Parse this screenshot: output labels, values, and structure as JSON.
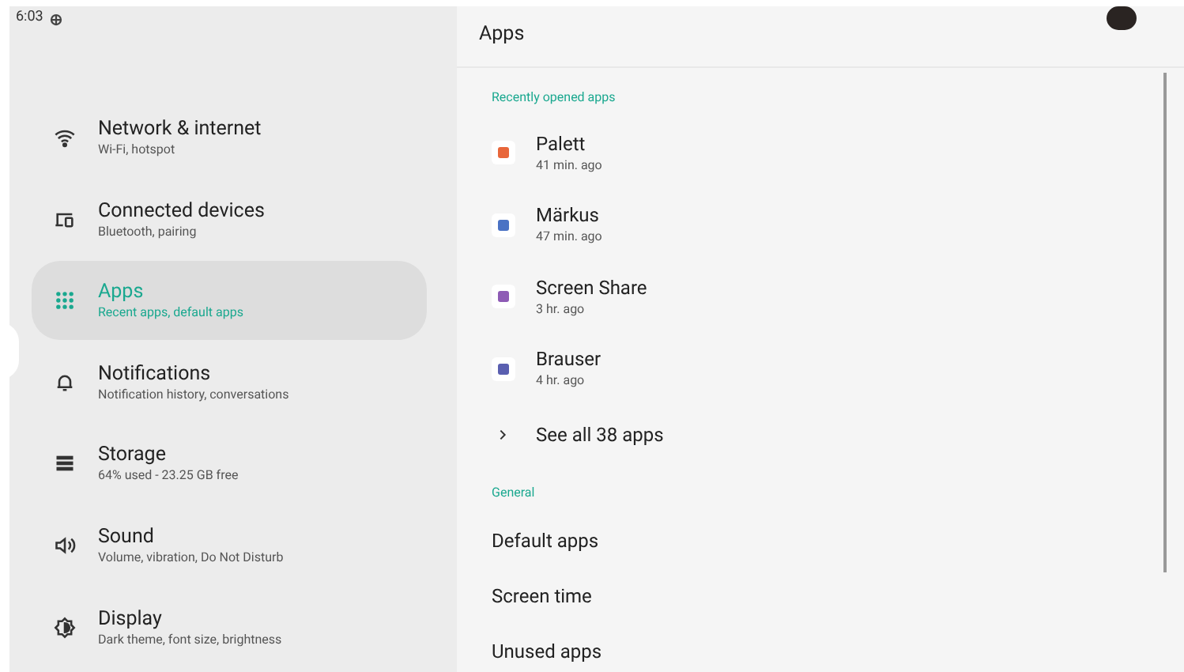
{
  "status_bar": {
    "time": "6:03"
  },
  "sidebar": {
    "items": [
      {
        "kind": "wifi",
        "title": "Network & internet",
        "subtitle": "Wi-Fi, hotspot",
        "selected": false
      },
      {
        "kind": "devices",
        "title": "Connected devices",
        "subtitle": "Bluetooth, pairing",
        "selected": false
      },
      {
        "kind": "apps",
        "title": "Apps",
        "subtitle": "Recent apps, default apps",
        "selected": true
      },
      {
        "kind": "bell",
        "title": "Notifications",
        "subtitle": "Notification history, conversations",
        "selected": false
      },
      {
        "kind": "storage",
        "title": "Storage",
        "subtitle": "64% used - 23.25 GB free",
        "selected": false
      },
      {
        "kind": "sound",
        "title": "Sound",
        "subtitle": "Volume, vibration, Do Not Disturb",
        "selected": false
      },
      {
        "kind": "display",
        "title": "Display",
        "subtitle": "Dark theme, font size, brightness",
        "selected": false
      }
    ]
  },
  "page": {
    "title": "Apps",
    "recent_header": "Recently opened apps",
    "recent_apps": [
      {
        "name": "Palett",
        "time": "41 min. ago",
        "color": "#e8663a"
      },
      {
        "name": "Märkus",
        "time": "47 min. ago",
        "color": "#4a72c4"
      },
      {
        "name": "Screen Share",
        "time": "3 hr. ago",
        "color": "#8e5bb5"
      },
      {
        "name": "Brauser",
        "time": "4 hr. ago",
        "color": "#5a5fb0"
      }
    ],
    "see_all": "See all 38 apps",
    "general_header": "General",
    "general_items": [
      "Default apps",
      "Screen time",
      "Unused apps"
    ]
  }
}
